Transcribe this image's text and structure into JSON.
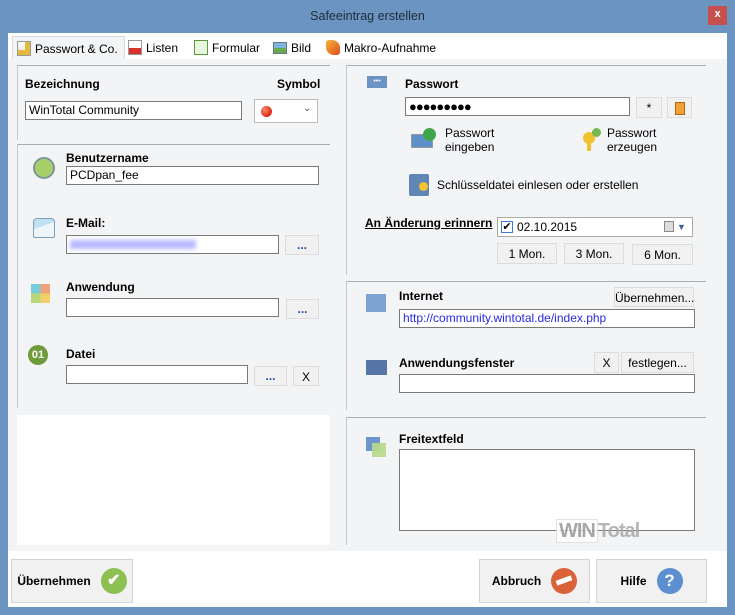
{
  "window": {
    "title": "Safeeintrag erstellen",
    "close_label": "x"
  },
  "tabs": [
    {
      "label": "Passwort & Co."
    },
    {
      "label": "Listen"
    },
    {
      "label": "Formular"
    },
    {
      "label": "Bild"
    },
    {
      "label": "Makro-Aufnahme"
    }
  ],
  "left": {
    "bezeichnung_label": "Bezeichnung",
    "bezeichnung_value": "WinTotal Community",
    "symbol_label": "Symbol",
    "symbol_color": "#e2341d",
    "benutzername_label": "Benutzername",
    "benutzername_value": "PCDpan_fee",
    "email_label": "E-Mail:",
    "email_browse": "...",
    "anwendung_label": "Anwendung",
    "anwendung_value": "",
    "anwendung_browse": "...",
    "datei_label": "Datei",
    "datei_value": "",
    "datei_browse": "...",
    "datei_clear": "X"
  },
  "right": {
    "passwort_label": "Passwort",
    "passwort_value": "●●●●●●●●●",
    "show_label": "*",
    "passwort_eingeben": "Passwort\neingeben",
    "passwort_erzeugen": "Passwort\nerzeugen",
    "schluesseldatei": "Schlüsseldatei einlesen oder erstellen",
    "erinnern_label": "An Änderung erinnern",
    "erinnern_checked": true,
    "erinnern_date": "02.10.2015",
    "mon1": "1 Mon.",
    "mon3": "3 Mon.",
    "mon6": "6 Mon.",
    "internet_label": "Internet",
    "internet_value": "http://community.wintotal.de/index.php",
    "uebernehmen_small": "Übernehmen...",
    "anwfenster_label": "Anwendungsfenster",
    "anwfenster_value": "",
    "anwfenster_clear": "X",
    "festlegen": "festlegen...",
    "freitext_label": "Freitextfeld",
    "freitext_value": ""
  },
  "footer": {
    "uebernehmen": "Übernehmen",
    "abbruch": "Abbruch",
    "hilfe": "Hilfe"
  },
  "watermark": "WINTotal"
}
